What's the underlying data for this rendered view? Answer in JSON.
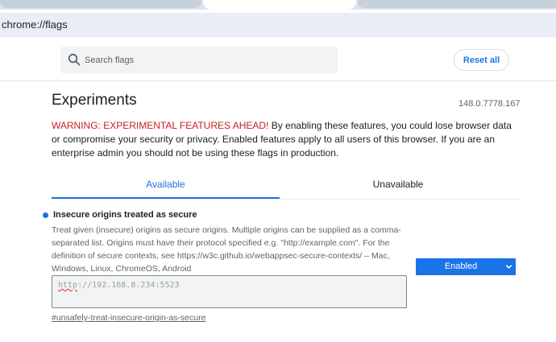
{
  "browser": {
    "url": "chrome://flags"
  },
  "header": {
    "search_placeholder": "Search flags",
    "reset_label": "Reset all"
  },
  "page": {
    "title": "Experiments",
    "version": "148.0.7778.167",
    "warning_prefix": "WARNING: EXPERIMENTAL FEATURES AHEAD!",
    "warning_body": " By enabling these features, you could lose browser data or compromise your security or privacy. Enabled features apply to all users of this browser. If you are an enterprise admin you should not be using these flags in production."
  },
  "tabs": {
    "available": "Available",
    "unavailable": "Unavailable"
  },
  "experiment": {
    "title": "Insecure origins treated as secure",
    "description": "Treat given (insecure) origins as secure origins. Multiple origins can be supplied as a comma-separated list. Origins must have their protocol specified e.g. \"http://example.com\". For the definition of secure contexts, see https://w3c.github.io/webappsec-secure-contexts/ – Mac, Windows, Linux, ChromeOS, Android",
    "select_value": "Enabled",
    "textarea_scheme": "http",
    "textarea_rest": "://192.168.8.234:5523",
    "link": "#unsafely-treat-insecure-origin-as-secure"
  },
  "colors": {
    "accent": "#1a73e8",
    "warning": "#c5221f"
  }
}
